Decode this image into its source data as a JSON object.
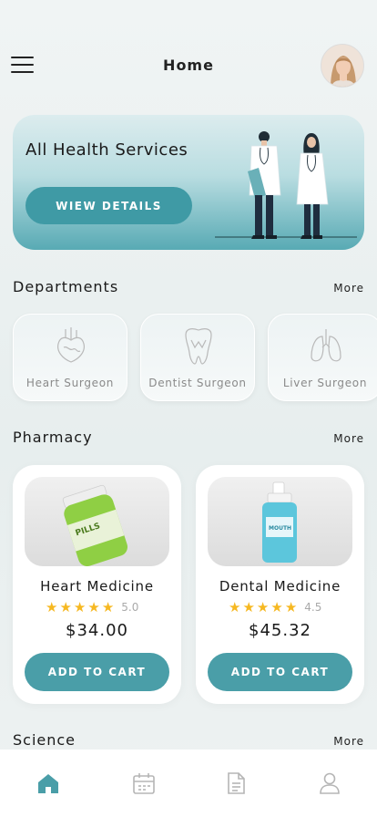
{
  "header": {
    "title": "Home"
  },
  "banner": {
    "title": "All Health Services",
    "button_label": "WIEW DETAILS"
  },
  "departments": {
    "title": "Departments",
    "more_label": "More",
    "items": [
      {
        "label": "Heart Surgeon",
        "icon": "heart-icon"
      },
      {
        "label": "Dentist Surgeon",
        "icon": "tooth-icon"
      },
      {
        "label": "Liver Surgeon",
        "icon": "lungs-icon"
      }
    ]
  },
  "pharmacy": {
    "title": "Pharmacy",
    "more_label": "More",
    "products": [
      {
        "name": "Heart Medicine",
        "rating": "5.0",
        "price": "$34.00",
        "button_label": "ADD TO CART",
        "stars": 5
      },
      {
        "name": "Dental Medicine",
        "rating": "4.5",
        "price": "$45.32",
        "button_label": "ADD TO CART",
        "stars": 5
      }
    ],
    "pill_label": "PILLS",
    "mouthwash_label": "MOUTH"
  },
  "science": {
    "title": "Science",
    "more_label": "More"
  },
  "bottom_nav": {
    "items": [
      {
        "icon": "home-icon",
        "active": true
      },
      {
        "icon": "calendar-icon",
        "active": false
      },
      {
        "icon": "document-icon",
        "active": false
      },
      {
        "icon": "user-icon",
        "active": false
      }
    ]
  },
  "colors": {
    "accent": "#4a9ea8",
    "star": "#f6b821",
    "inactive_icon": "#b5b5b5"
  }
}
